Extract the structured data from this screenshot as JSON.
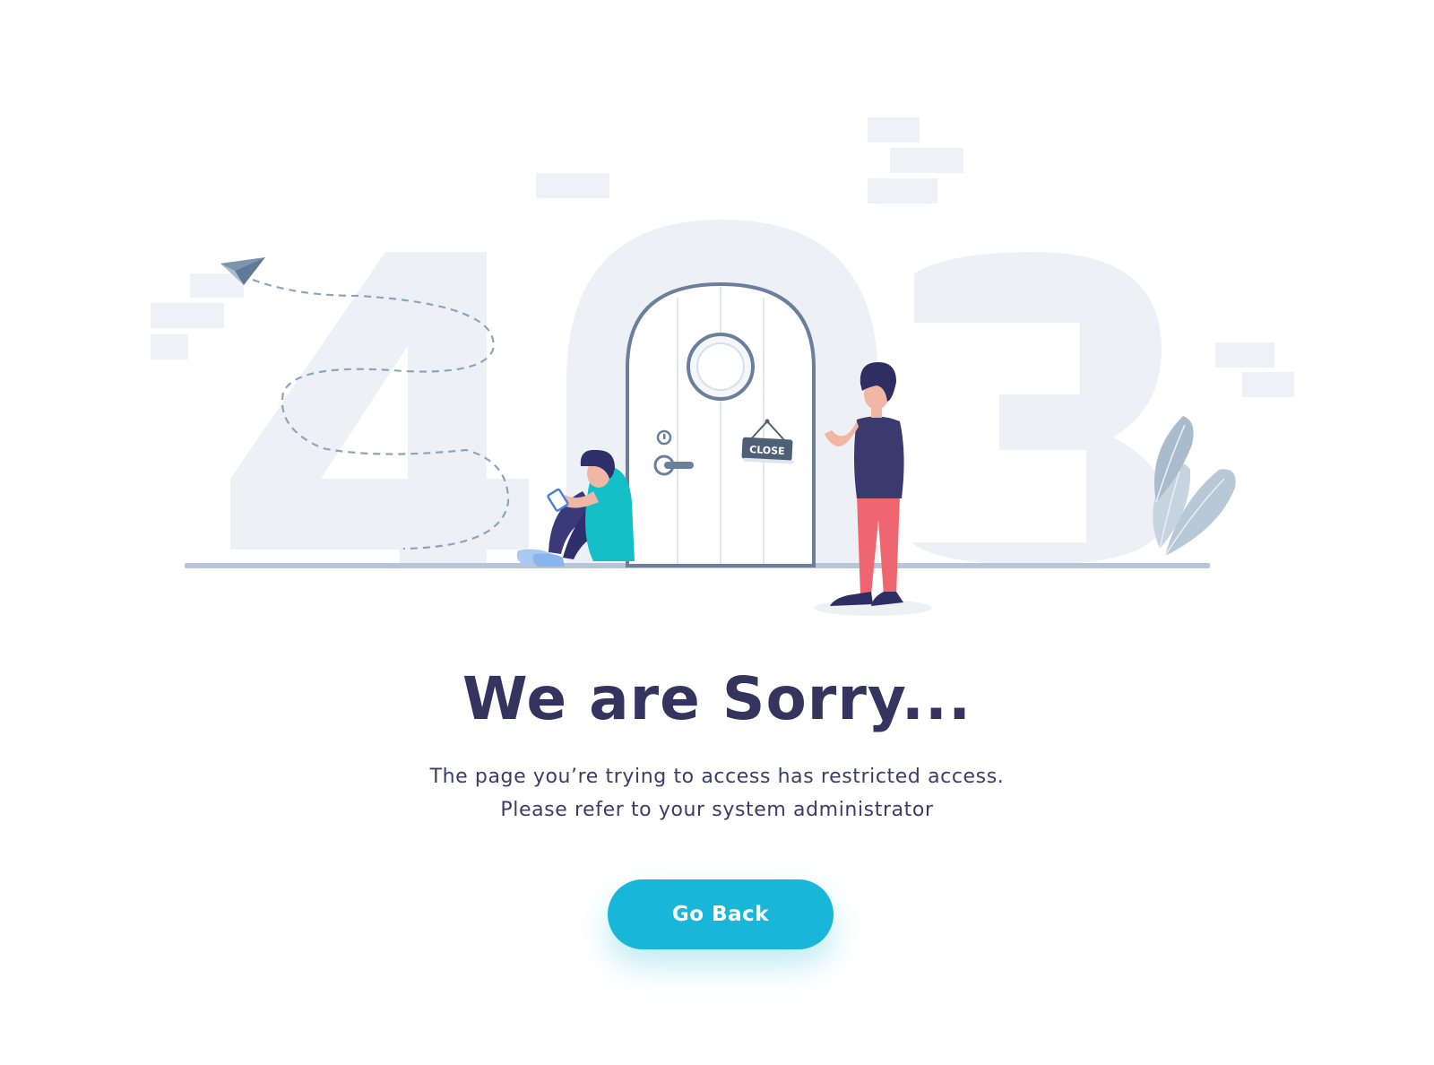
{
  "illustration": {
    "door_sign": "CLOSE",
    "error_code": [
      "4",
      "0",
      "3"
    ]
  },
  "error_page": {
    "heading": "We are Sorry...",
    "message_lines": [
      "The page you’re trying to access has restricted access.",
      "Please refer to your system administrator"
    ],
    "go_back_label": "Go Back"
  },
  "colors": {
    "heading": "#34345f",
    "body_text": "#3c3c68",
    "button": "#18b6d8",
    "illustration_bg": "#eef2f6",
    "door_frame": "#6b7f9c"
  },
  "icons": [
    "paper-plane-icon",
    "leaf-plant-icon",
    "door-lock-icon"
  ]
}
